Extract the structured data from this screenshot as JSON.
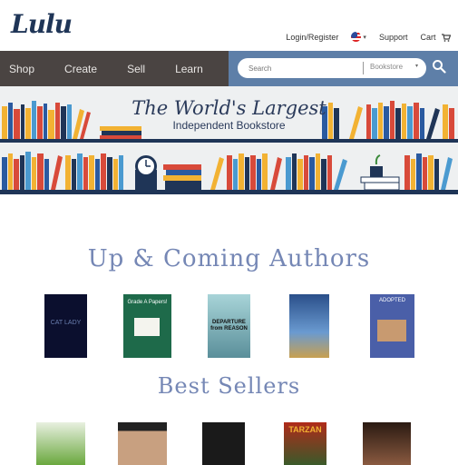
{
  "header": {
    "logo_text": "Lulu",
    "login_label": "Login/Register",
    "locale_caret": "▾",
    "support_label": "Support",
    "cart_label": "Cart"
  },
  "nav": {
    "items": [
      "Shop",
      "Create",
      "Sell",
      "Learn"
    ]
  },
  "search": {
    "placeholder": "Search",
    "scope": "Bookstore",
    "scope_caret": "▾"
  },
  "banner": {
    "title": "The World's Largest",
    "subtitle": "Independent Bookstore"
  },
  "sections": {
    "authors_title": "Up & Coming Authors",
    "sellers_title": "Best Sellers"
  },
  "authors_books": [
    {
      "caption": "CAT LADY",
      "bg": "#0b0f2e"
    },
    {
      "caption": "Grade A Papers!",
      "bg": "#1e6a4a"
    },
    {
      "caption": "DEPARTURE from REASON",
      "bg": "#5a8f9a"
    },
    {
      "caption": "",
      "bg": "#3e6ea8"
    },
    {
      "caption": "ADOPTED",
      "bg": "#4a5fa8"
    }
  ],
  "sellers_books": [
    {
      "caption": "",
      "bg": "#6aa83e"
    },
    {
      "caption": "",
      "bg": "#c8a080"
    },
    {
      "caption": "",
      "bg": "#1a1a1a"
    },
    {
      "caption": "TARZAN",
      "bg": "#b02a1a"
    },
    {
      "caption": "",
      "bg": "#5a3a28"
    }
  ],
  "colors": {
    "nav_bg": "#4a4442",
    "search_bg": "#5e7fa8",
    "heading": "#7587b5",
    "logo": "#1f3557"
  }
}
